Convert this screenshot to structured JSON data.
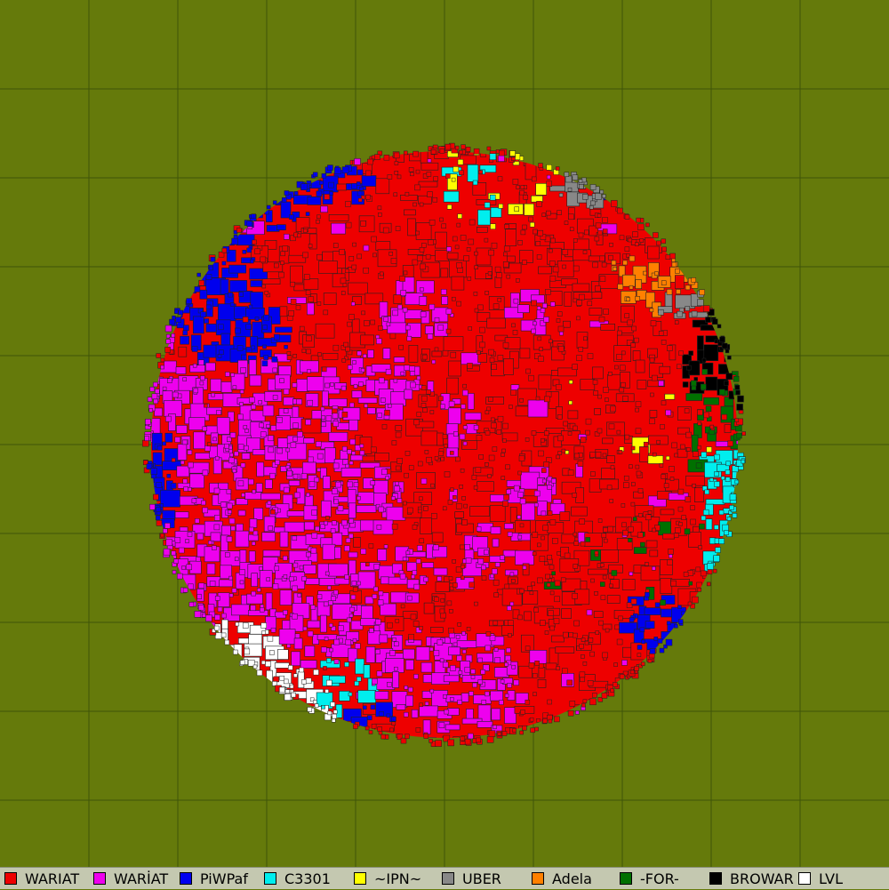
{
  "map": {
    "background_color": "#657a0b",
    "grid_color": "#3e5408",
    "planet": {
      "base_color": "#ee0000",
      "outline_color": "#222222"
    },
    "regions": [
      {
        "alliance": "WARIAT",
        "color": "#ee0000",
        "area": "center / east"
      },
      {
        "alliance": "WARİAT",
        "color": "#ee00ee",
        "area": "west / south-west"
      },
      {
        "alliance": "PiWPaf",
        "color": "#0000ee",
        "area": "north-west rim"
      },
      {
        "alliance": "C3301",
        "color": "#00eeee",
        "area": "east rim / south"
      },
      {
        "alliance": "~IPN~",
        "color": "#ffff00",
        "area": "north / east scattered"
      },
      {
        "alliance": "UBER",
        "color": "#888888",
        "area": "north-east"
      },
      {
        "alliance": "Adela",
        "color": "#ff8000",
        "area": "north-east"
      },
      {
        "alliance": "-FOR-",
        "color": "#007000",
        "area": "east rim"
      },
      {
        "alliance": "BROWAR",
        "color": "#000000",
        "area": "east rim"
      },
      {
        "alliance": "LVL",
        "color": "#ffffff",
        "area": "south-west rim"
      }
    ]
  },
  "legend": {
    "items": [
      {
        "label": "WARIAT",
        "color": "#ee0000"
      },
      {
        "label": "WARİAT",
        "color": "#ee00ee"
      },
      {
        "label": "PiWPaf",
        "color": "#0000ee"
      },
      {
        "label": "C3301",
        "color": "#00eeee"
      },
      {
        "label": "~IPN~",
        "color": "#ffff00"
      },
      {
        "label": "UBER",
        "color": "#888888"
      },
      {
        "label": "Adela",
        "color": "#ff8000"
      },
      {
        "label": "-FOR-",
        "color": "#007000"
      },
      {
        "label": "BROWAR",
        "color": "#000000"
      },
      {
        "label": "LVL",
        "color": "#ffffff"
      }
    ]
  }
}
